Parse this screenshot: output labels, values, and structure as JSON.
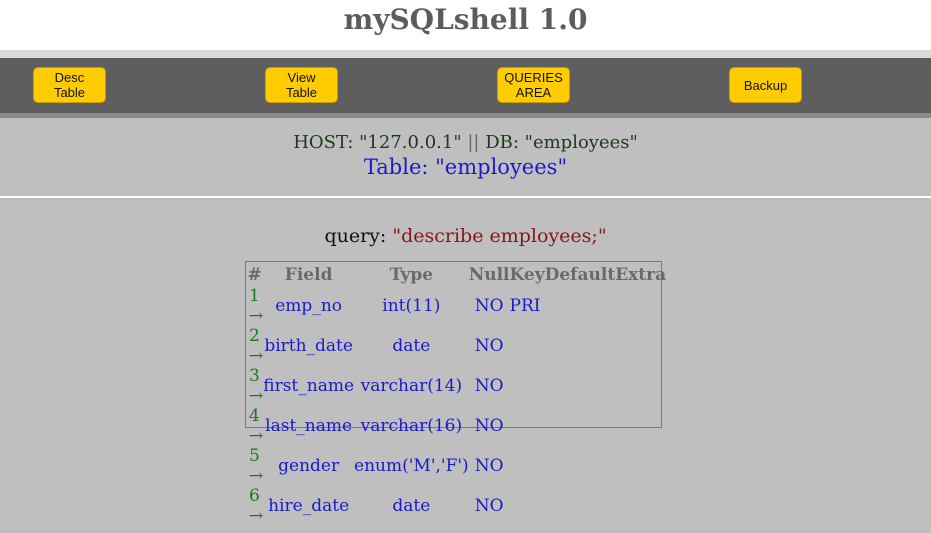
{
  "app": {
    "title": "mySQLshell 1.0"
  },
  "toolbar": {
    "buttons": [
      {
        "label": "Desc\nTable"
      },
      {
        "label": "View\nTable"
      },
      {
        "label": "QUERIES\nAREA"
      },
      {
        "label": "Backup"
      }
    ]
  },
  "connection": {
    "host_label": "HOST:",
    "host": "\"127.0.0.1\"",
    "separator": "||",
    "db_label": "DB:",
    "db": "\"employees\"",
    "table_label": "Table:",
    "table": "\"employees\""
  },
  "query": {
    "label": "query:",
    "text": "\"describe employees;\""
  },
  "result": {
    "columns": [
      "#",
      "Field",
      "Type",
      "Null",
      "Key",
      "Default",
      "Extra"
    ],
    "rows": [
      {
        "num": "1 →",
        "field": "emp_no",
        "type": "int(11)",
        "null": "NO",
        "key": "PRI",
        "default": "",
        "extra": ""
      },
      {
        "num": "2 →",
        "field": "birth_date",
        "type": "date",
        "null": "NO",
        "key": "",
        "default": "",
        "extra": ""
      },
      {
        "num": "3 →",
        "field": "first_name",
        "type": "varchar(14)",
        "null": "NO",
        "key": "",
        "default": "",
        "extra": ""
      },
      {
        "num": "4 →",
        "field": "last_name",
        "type": "varchar(16)",
        "null": "NO",
        "key": "",
        "default": "",
        "extra": ""
      },
      {
        "num": "5 →",
        "field": "gender",
        "type": "enum('M','F')",
        "null": "NO",
        "key": "",
        "default": "",
        "extra": ""
      },
      {
        "num": "6 →",
        "field": "hire_date",
        "type": "date",
        "null": "NO",
        "key": "",
        "default": "",
        "extra": ""
      }
    ]
  }
}
